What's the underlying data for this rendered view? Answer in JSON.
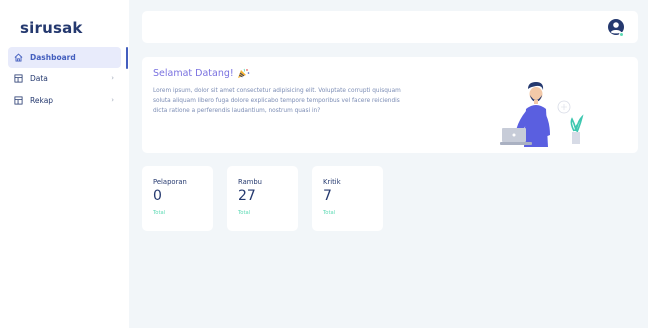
{
  "app": {
    "brand": "sirusak"
  },
  "sidebar": {
    "items": [
      {
        "label": "Dashboard",
        "icon": "home-icon",
        "active": true
      },
      {
        "label": "Data",
        "icon": "table-icon",
        "has_submenu": true
      },
      {
        "label": "Rekap",
        "icon": "table-icon",
        "has_submenu": true
      }
    ]
  },
  "header": {
    "user_icon": "user-circle-icon",
    "status": "online"
  },
  "welcome": {
    "title": "Selamat Datang!",
    "title_icon": "party-popper-icon",
    "body": "Lorem ipsum, dolor sit amet consectetur adipisicing elit. Voluptate corrupti quisquam soluta aliquam libero fuga dolore explicabo tempore temporibus vel facere reiciendis dicta ratione a perferendis laudantium, nostrum quasi in?"
  },
  "stats": [
    {
      "label": "Pelaporan",
      "value": "0",
      "sub": "Total"
    },
    {
      "label": "Rambu",
      "value": "27",
      "sub": "Total"
    },
    {
      "label": "Kritik",
      "value": "7",
      "sub": "Total"
    }
  ],
  "colors": {
    "primary": "#435ebe",
    "accent": "#7a72e0",
    "success": "#5ddab4",
    "text": "#25396f",
    "muted": "#7c8db5"
  }
}
